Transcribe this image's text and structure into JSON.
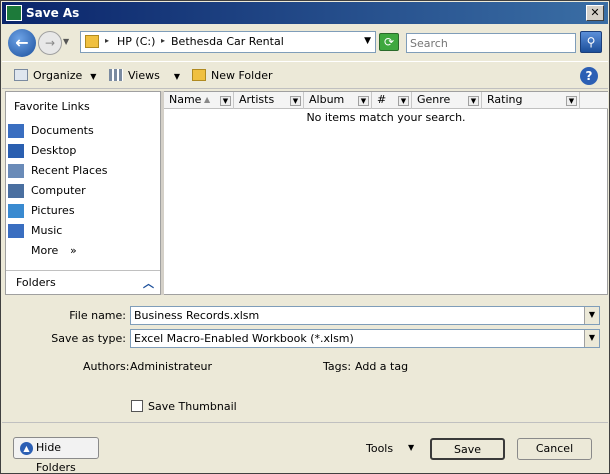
{
  "window": {
    "title": "Save As",
    "close_label": "✕"
  },
  "nav": {
    "back_glyph": "←",
    "forward_glyph": "→",
    "breadcrumb": [
      "HP (C:)",
      "Bethesda Car Rental"
    ],
    "search_placeholder": "Search"
  },
  "toolbar": {
    "organize_label": "Organize",
    "views_label": "Views",
    "new_folder_label": "New Folder",
    "help_label": "?"
  },
  "sidebar": {
    "favorites_title": "Favorite Links",
    "items": [
      {
        "label": "Documents",
        "icon": "documents-icon",
        "color": "#3a6ec0"
      },
      {
        "label": "Desktop",
        "icon": "desktop-icon",
        "color": "#2a5fb0"
      },
      {
        "label": "Recent Places",
        "icon": "recent-places-icon",
        "color": "#6a8bb8"
      },
      {
        "label": "Computer",
        "icon": "computer-icon",
        "color": "#4a6fa0"
      },
      {
        "label": "Pictures",
        "icon": "pictures-icon",
        "color": "#3a8ad0"
      },
      {
        "label": "Music",
        "icon": "music-icon",
        "color": "#3a6ec0"
      }
    ],
    "more_label": "More",
    "more_chevron": "»",
    "folders_label": "Folders"
  },
  "filelist": {
    "columns": [
      "Name",
      "Artists",
      "Album",
      "#",
      "Genre",
      "Rating"
    ],
    "empty_message": "No items match your search."
  },
  "form": {
    "file_name_label": "File name:",
    "file_name_value": "Business Records.xlsm",
    "save_type_label": "Save as type:",
    "save_type_value": "Excel Macro-Enabled Workbook (*.xlsm)",
    "authors_label": "Authors:",
    "authors_value": "Administrateur",
    "tags_label": "Tags:",
    "tags_value": "Add a tag",
    "thumbnail_label": "Save Thumbnail"
  },
  "footer": {
    "hide_folders_label": "Hide Folders",
    "tools_label": "Tools",
    "save_label": "Save",
    "cancel_label": "Cancel"
  }
}
